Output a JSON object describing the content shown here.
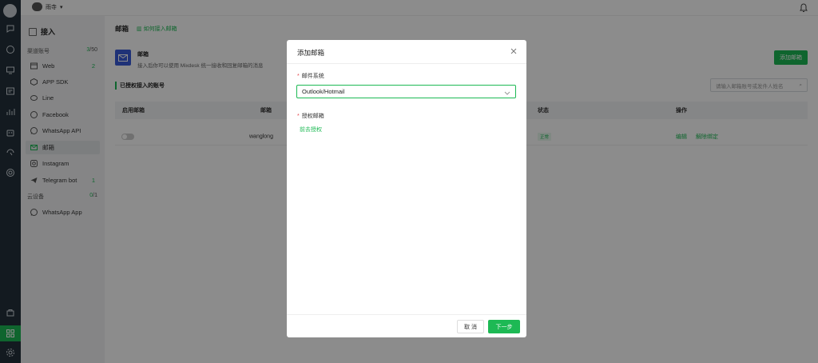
{
  "topbar": {
    "brand": "雨寺",
    "bell_icon": "bell-icon"
  },
  "sidebar": {
    "title": "接入",
    "channel_section": {
      "label": "渠道账号",
      "count_used": "3",
      "count_total": "/50"
    },
    "items": [
      {
        "label": "Web",
        "icon": "browser-icon",
        "count": "2"
      },
      {
        "label": "APP SDK",
        "icon": "cube-icon",
        "count": ""
      },
      {
        "label": "Line",
        "icon": "line-icon",
        "count": ""
      },
      {
        "label": "Facebook",
        "icon": "facebook-icon",
        "count": ""
      },
      {
        "label": "WhatsApp API",
        "icon": "whatsapp-icon",
        "count": ""
      },
      {
        "label": "邮箱",
        "icon": "mail-icon",
        "count": "",
        "active": true
      },
      {
        "label": "Instagram",
        "icon": "instagram-icon",
        "count": ""
      },
      {
        "label": "Telegram bot",
        "icon": "telegram-icon",
        "count": "1"
      }
    ],
    "device_section": {
      "label": "云设备",
      "count_used": "0",
      "count_total": "/1"
    },
    "device_items": [
      {
        "label": "WhatsApp App",
        "icon": "whatsapp-icon"
      }
    ]
  },
  "main": {
    "title": "邮箱",
    "help_link": "如何接入邮箱",
    "card_title": "邮箱",
    "card_desc": "接入后你可以使用 Mixdesk 统一接收和回复邮箱的消息",
    "add_button": "添加邮箱",
    "authorized_title": "已授权接入的账号",
    "search_placeholder": "请输入邮箱账号或发件人姓名",
    "table": {
      "headers": [
        "启用邮箱",
        "邮箱",
        "状态",
        "操作"
      ],
      "rows": [
        {
          "email": "wanglong",
          "status": "正常",
          "edit": "编辑",
          "unbind": "解除绑定"
        }
      ]
    }
  },
  "modal": {
    "title": "添加邮箱",
    "field1_label": "邮件系统",
    "field1_value": "Outlook/Hotmail",
    "field2_label": "授权邮箱",
    "auth_link": "前去授权",
    "cancel": "取 消",
    "next": "下一步"
  },
  "colors": {
    "accent": "#1db954",
    "rail": "#24313b",
    "mail_icon_bg": "#3a5bd9"
  }
}
